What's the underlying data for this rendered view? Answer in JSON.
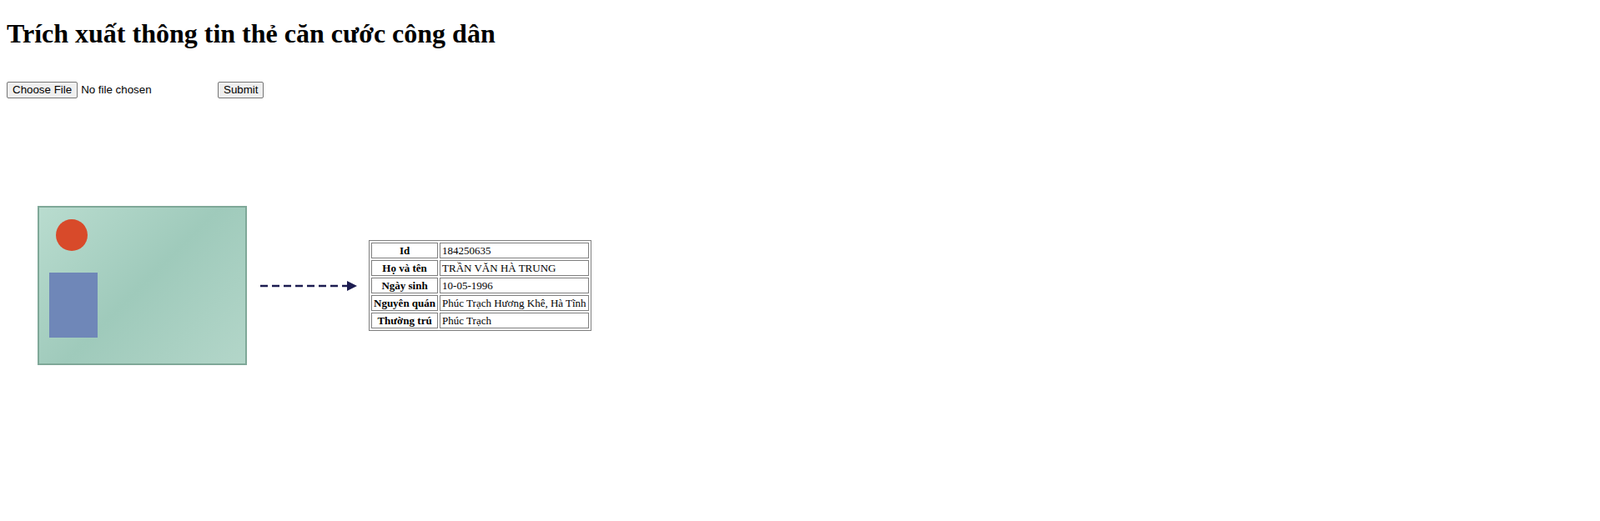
{
  "title": "Trích xuất thông tin thẻ căn cước công dân",
  "form": {
    "choose_button": "Choose File",
    "file_status": "No file chosen",
    "submit": "Submit"
  },
  "result": {
    "rows": [
      {
        "label": "Id",
        "value": "184250635"
      },
      {
        "label": "Họ và tên",
        "value": "TRẦN VĂN HÀ TRUNG"
      },
      {
        "label": "Ngày sinh",
        "value": "10-05-1996"
      },
      {
        "label": "Nguyên quán",
        "value": "Phúc Trạch Hương Khê, Hà Tĩnh"
      },
      {
        "label": "Thường trú",
        "value": "Phúc Trạch"
      }
    ]
  }
}
